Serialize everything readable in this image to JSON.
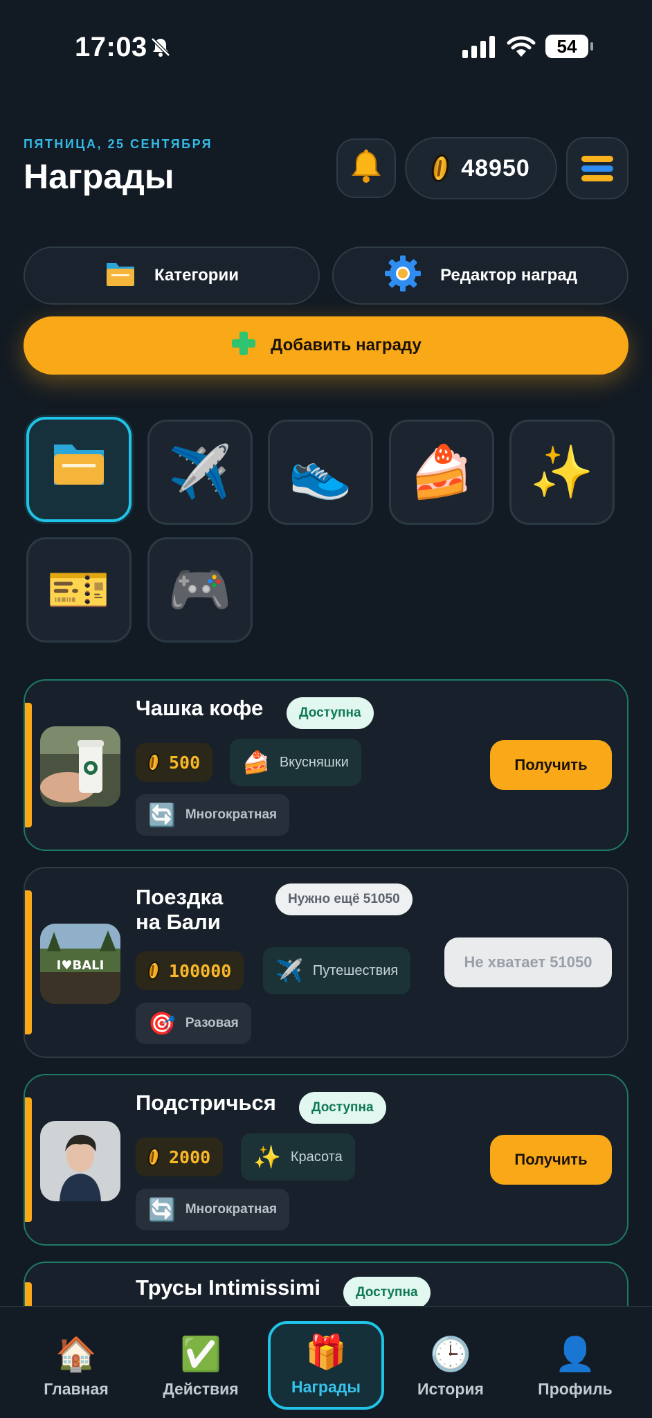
{
  "status_bar": {
    "time": "17:03",
    "battery": "54"
  },
  "header": {
    "date": "ПЯТНИЦА, 25 СЕНТЯБРЯ",
    "title": "Награды",
    "coins": "48950"
  },
  "actions": {
    "categories_label": "Категории",
    "editor_label": "Редактор наград",
    "add_label": "Добавить награду"
  },
  "category_icons": [
    "folder-icon",
    "airplane-icon",
    "sneaker-icon",
    "cake-icon",
    "sparkles-icon",
    "ticket-icon",
    "gamepad-icon"
  ],
  "rewards": [
    {
      "name": "Чашка кофе",
      "badge": "Доступна",
      "price": "500",
      "category": "Вкусняшки",
      "kind": "Многократная",
      "action": "Получить",
      "available": true
    },
    {
      "name_line1": "Поездка",
      "name_line2": "на Бали",
      "badge": "Нужно ещё 51050",
      "price": "100000",
      "category": "Путешествия",
      "kind": "Разовая",
      "action": "Не хватает 51050",
      "available": false
    },
    {
      "name": "Подстричься",
      "badge": "Доступна",
      "price": "2000",
      "category": "Красота",
      "kind": "Многократная",
      "action": "Получить",
      "available": true
    },
    {
      "name": "Трусы Intimissimi",
      "badge": "Доступна",
      "available": true
    }
  ],
  "bottom_nav": [
    {
      "label": "Главная",
      "icon": "house-icon"
    },
    {
      "label": "Действия",
      "icon": "checkmark-icon"
    },
    {
      "label": "Награды",
      "icon": "gift-icon",
      "active": true
    },
    {
      "label": "История",
      "icon": "clock-icon"
    },
    {
      "label": "Профиль",
      "icon": "person-icon"
    }
  ],
  "colors": {
    "accent": "#f9a918",
    "cyan": "#1fc4e6",
    "available_border": "#1e7a68",
    "background": "#121a23"
  }
}
